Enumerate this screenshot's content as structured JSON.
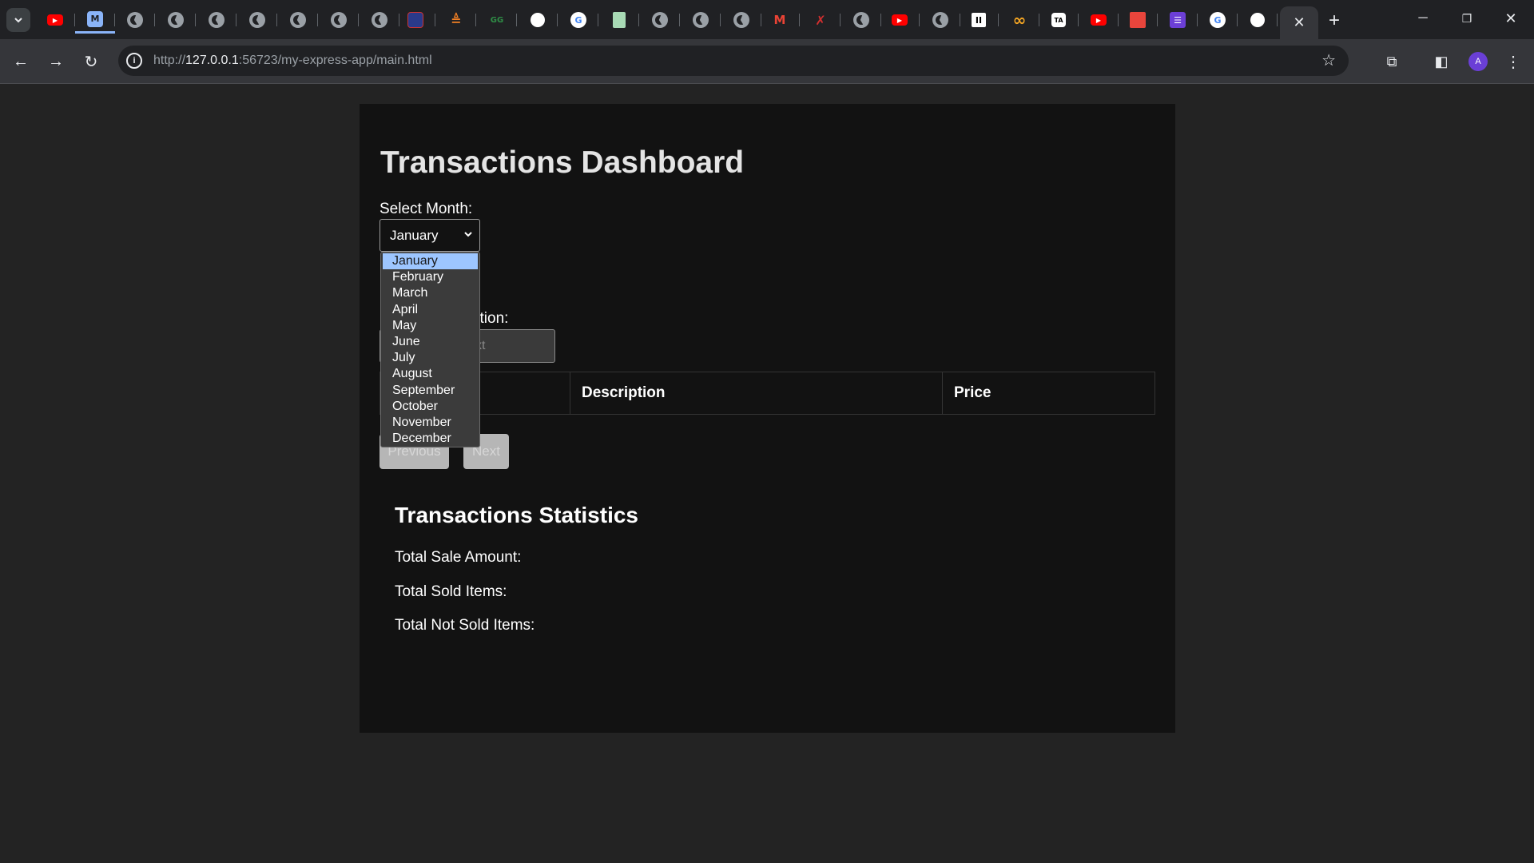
{
  "browser": {
    "tabs": [
      {
        "icon": "youtube-icon",
        "color": "#ff0000"
      },
      {
        "icon": "m-app-icon",
        "label": "M"
      },
      {
        "icon": "globe-icon"
      },
      {
        "icon": "globe-icon"
      },
      {
        "icon": "globe-icon"
      },
      {
        "icon": "globe-icon"
      },
      {
        "icon": "globe-icon"
      },
      {
        "icon": "globe-icon"
      },
      {
        "icon": "globe-icon"
      },
      {
        "icon": "news-icon"
      },
      {
        "icon": "stack-icon"
      },
      {
        "icon": "gfg-icon",
        "label": "GG"
      },
      {
        "icon": "github-icon"
      },
      {
        "icon": "google-icon",
        "label": "G"
      },
      {
        "icon": "sheets-icon"
      },
      {
        "icon": "globe-icon"
      },
      {
        "icon": "globe-icon"
      },
      {
        "icon": "globe-icon"
      },
      {
        "icon": "gmail-icon",
        "label": "M"
      },
      {
        "icon": "figure-icon"
      },
      {
        "icon": "globe-icon"
      },
      {
        "icon": "youtube-icon"
      },
      {
        "icon": "globe-icon"
      },
      {
        "icon": "pause-icon"
      },
      {
        "icon": "infinity-icon",
        "label": "∞"
      },
      {
        "icon": "ta-icon",
        "label": "TA"
      },
      {
        "icon": "youtube-icon"
      },
      {
        "icon": "pdf-icon"
      },
      {
        "icon": "list-icon"
      },
      {
        "icon": "google-icon",
        "label": "G"
      },
      {
        "icon": "github-icon"
      }
    ],
    "active_tab_close": "✕",
    "new_tab": "+",
    "url_prefix": "http://",
    "url_host": "127.0.0.1",
    "url_rest": ":56723/my-express-app/main.html",
    "avatar": "A"
  },
  "page": {
    "title": "Transactions Dashboard",
    "month_label": "Select Month:",
    "selected_month": "January",
    "months": [
      "January",
      "February",
      "March",
      "April",
      "May",
      "June",
      "July",
      "August",
      "September",
      "October",
      "November",
      "December"
    ],
    "search_label_visible": "ction:",
    "search_placeholder_visible": "xt",
    "table_headers": [
      "",
      "Description",
      "Price"
    ],
    "prev_label": "Previous",
    "next_label": "Next",
    "stats_title": "Transactions Statistics",
    "stat_sale": "Total Sale Amount:",
    "stat_sold": "Total Sold Items:",
    "stat_not_sold": "Total Not Sold Items:"
  }
}
